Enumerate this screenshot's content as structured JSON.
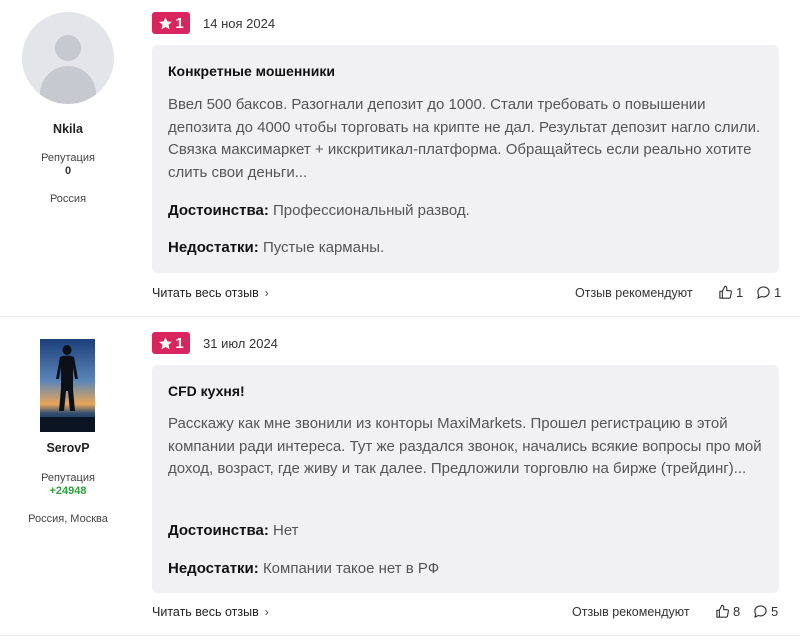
{
  "reviews": [
    {
      "author": {
        "name": "Nkila",
        "reputation_label": "Репутация",
        "reputation": "0",
        "location": "Россия"
      },
      "rating": "1",
      "date": "14 ноя 2024",
      "title": "Конкретные мошенники",
      "text": "Ввел 500 баксов. Разогнали депозит до 1000. Стали требовать о повышении депозита до 4000 чтобы торговать на крипте не дал. Результат депозит нагло слили. Связка максимаркет + икскритикал-платформа. Обращайтесь если реально хотите слить свои деньги...",
      "pros_label": "Достоинства:",
      "pros": "Профессиональный развод.",
      "cons_label": "Недостатки:",
      "cons": "Пустые карманы.",
      "read_more": "Читать весь отзыв",
      "recommend_label": "Отзыв рекомендуют",
      "likes": "1",
      "comments": "1"
    },
    {
      "author": {
        "name": "SerovP",
        "reputation_label": "Репутация",
        "reputation": "+24948",
        "location": "Россия, Москва"
      },
      "rating": "1",
      "date": "31 июл 2024",
      "title": "CFD кухня!",
      "text": "Расскажу как мне звонили из конторы MaxiMarkets. Прошел регистрацию в этой компании ради интереса. Тут же раздался звонок, начались всякие вопросы про мой доход, возраст, где живу и так далее. Предложили торговлю на бирже (трейдинг)...",
      "pros_label": "Достоинства:",
      "pros": "Нет",
      "cons_label": "Недостатки:",
      "cons": "Компании такое нет в РФ",
      "read_more": "Читать весь отзыв",
      "recommend_label": "Отзыв рекомендуют",
      "likes": "8",
      "comments": "5"
    }
  ],
  "colors": {
    "badge": "#d8245f",
    "card_bg": "#f1f1f3",
    "positive_rep": "#2e9d3e"
  },
  "icons": {
    "rating": "star-icon",
    "like": "thumbs-up-icon",
    "comment": "comment-icon",
    "chevron": "chevron-right-icon"
  }
}
